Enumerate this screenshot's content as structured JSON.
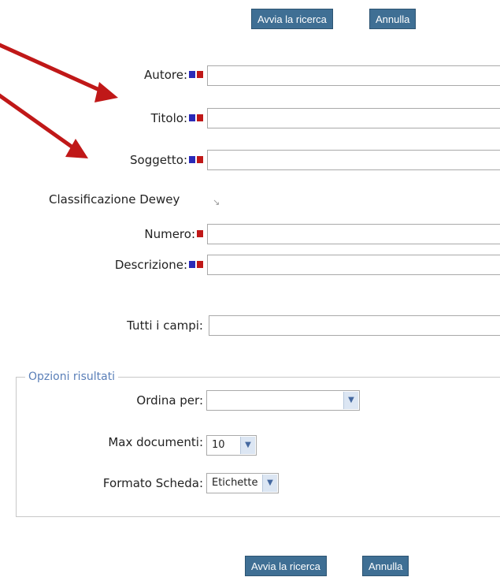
{
  "top_buttons": {
    "search": "Avvia la ricerca",
    "cancel": "Annulla"
  },
  "fields": {
    "autore": "Autore:",
    "titolo": "Titolo:",
    "soggetto": "Soggetto:",
    "dewey_heading": "Classificazione Dewey",
    "numero": "Numero:",
    "descrizione": "Descrizione:",
    "tutti": "Tutti i campi:"
  },
  "options": {
    "legend": "Opzioni risultati",
    "ordina_label": "Ordina per:",
    "ordina_value": "",
    "max_label": "Max documenti:",
    "max_value": "10",
    "formato_label": "Formato Scheda:",
    "formato_value": "Etichette"
  },
  "bottom_buttons": {
    "search": "Avvia la ricerca",
    "cancel": "Annulla"
  },
  "colors": {
    "button": "#3f6f94",
    "marker_blue": "#2a2ab8",
    "marker_red": "#c01818",
    "arrow": "#c01818",
    "legend_text": "#5a7fb8"
  },
  "icons": {
    "dewey_note": "small-arrow-icon",
    "dropdown": "chevron-down-icon"
  }
}
